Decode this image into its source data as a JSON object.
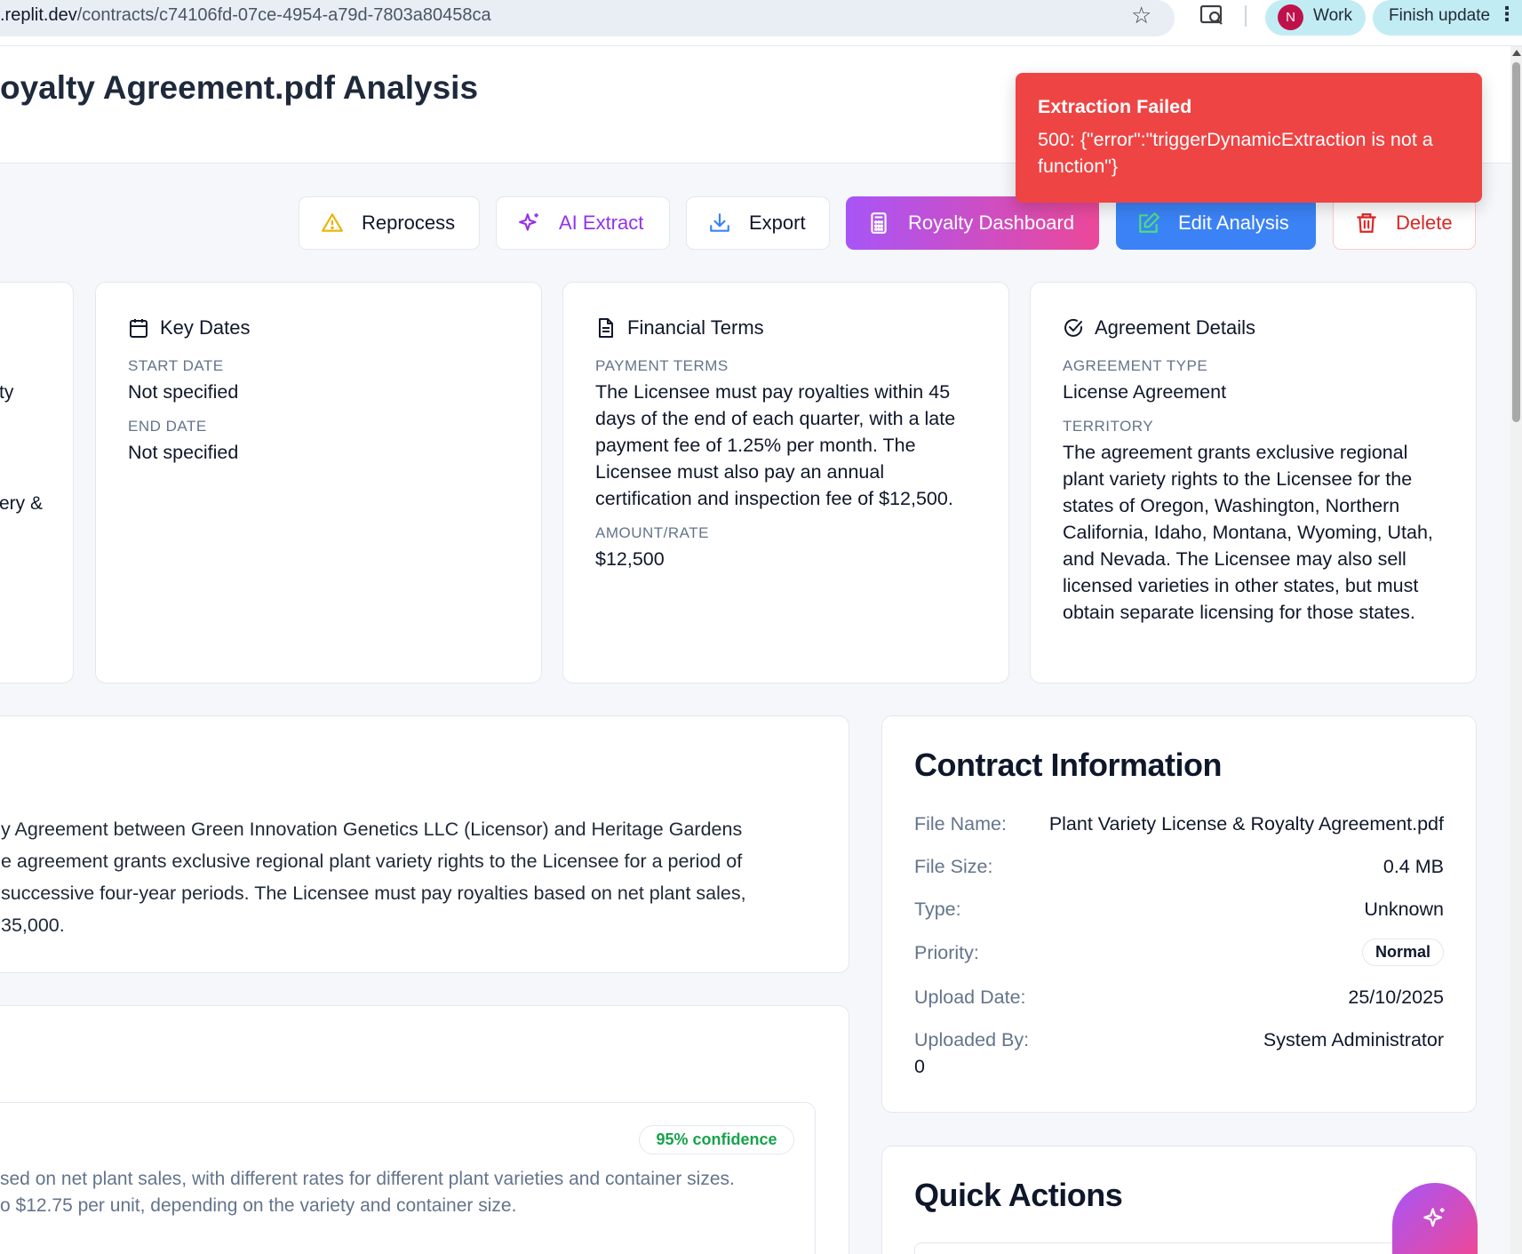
{
  "browser": {
    "url_host": ".replit.dev",
    "url_path": "/contracts/c74106fd-07ce-4954-a79d-7803a80458ca",
    "profile_initial": "N",
    "profile_label": "Work",
    "update_label": "Finish update"
  },
  "header": {
    "title": "oyalty Agreement.pdf Analysis"
  },
  "toast": {
    "title": "Extraction Failed",
    "message": "500: {\"error\":\"triggerDynamicExtraction is not a function\"}"
  },
  "toolbar": {
    "reprocess": "Reprocess",
    "ai_extract": "AI Extract",
    "export": "Export",
    "royalty_dashboard": "Royalty Dashboard",
    "edit_analysis": "Edit Analysis",
    "delete": "Delete"
  },
  "left_card_fragments": [
    "ty",
    "ery &"
  ],
  "key_dates": {
    "title": "Key Dates",
    "start_label": "START DATE",
    "start_value": "Not specified",
    "end_label": "END DATE",
    "end_value": "Not specified"
  },
  "financial_terms": {
    "title": "Financial Terms",
    "payment_label": "PAYMENT TERMS",
    "payment_value": "The Licensee must pay royalties within 45 days of the end of each quarter, with a late payment fee of 1.25% per month. The Licensee must also pay an annual certification and inspection fee of $12,500.",
    "amount_label": "AMOUNT/RATE",
    "amount_value": "$12,500"
  },
  "agreement_details": {
    "title": "Agreement Details",
    "type_label": "AGREEMENT TYPE",
    "type_value": "License Agreement",
    "territory_label": "TERRITORY",
    "territory_value": "The agreement grants exclusive regional plant variety rights to the Licensee for the states of Oregon, Washington, Northern California, Idaho, Montana, Wyoming, Utah, and Nevada. The Licensee may also sell licensed varieties in other states, but must obtain separate licensing for those states."
  },
  "summary": {
    "lines": [
      "y Agreement between Green Innovation Genetics LLC (Licensor) and Heritage Gardens",
      "e agreement grants exclusive regional plant variety rights to the Licensee for a period of",
      " successive four-year periods. The Licensee must pay royalties based on net plant sales,",
      "35,000."
    ]
  },
  "terms": {
    "confidence": "95% confidence",
    "lines": [
      "sed on net plant sales, with different rates for different plant varieties and container sizes.",
      "o $12.75 per unit, depending on the variety and container size."
    ]
  },
  "contract_info": {
    "title": "Contract Information",
    "file_name_label": "File Name:",
    "file_name": "Plant Variety License & Royalty Agreement.pdf",
    "file_size_label": "File Size:",
    "file_size": "0.4 MB",
    "type_label": "Type:",
    "type": "Unknown",
    "priority_label": "Priority:",
    "priority": "Normal",
    "upload_date_label": "Upload Date:",
    "upload_date": "25/10/2025",
    "uploaded_by_label": "Uploaded By:",
    "uploaded_by": "System Administrator",
    "uploaded_by_id": "0"
  },
  "quick_actions": {
    "title": "Quick Actions"
  },
  "colors": {
    "toast": "#ef4444",
    "royalty_gradient_start": "#a855f7",
    "royalty_gradient_end": "#ec4899",
    "edit_blue": "#3b82f6",
    "delete_red": "#dc2626",
    "confidence_green": "#16a34a"
  },
  "icons": {
    "reprocess": "warning-triangle-icon",
    "ai_extract": "sparkles-icon",
    "export": "download-icon",
    "royalty_dashboard": "calculator-icon",
    "edit_analysis": "edit-icon",
    "delete": "trash-icon",
    "key_dates": "calendar-icon",
    "financial_terms": "file-text-icon",
    "agreement_details": "check-circle-icon",
    "fab": "sparkles-icon"
  }
}
